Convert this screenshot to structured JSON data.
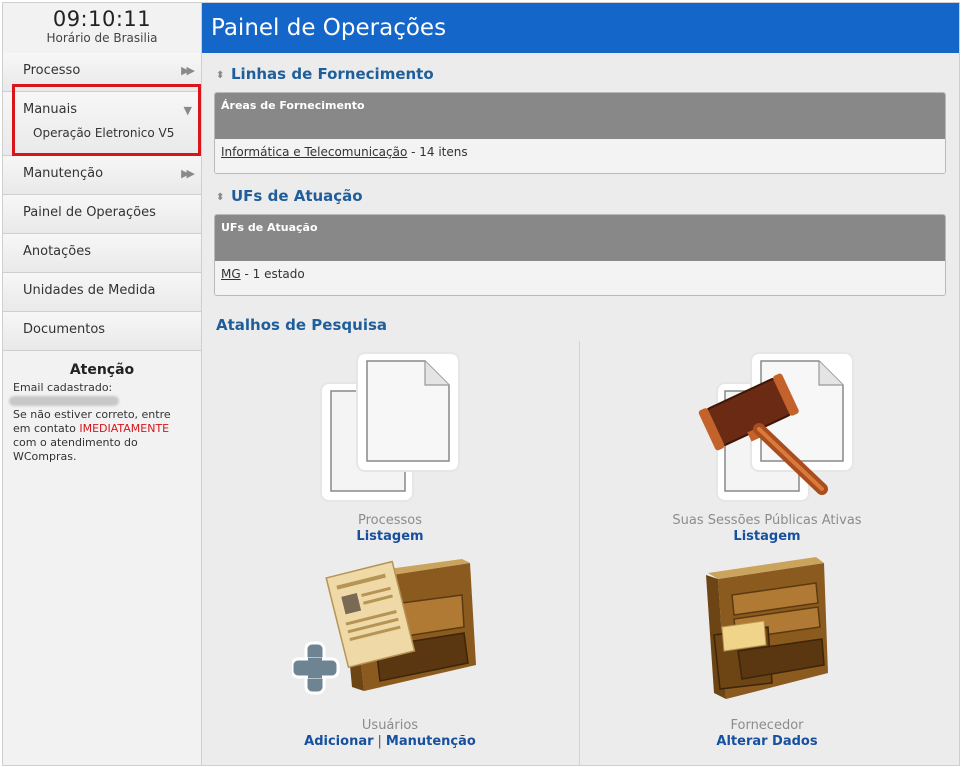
{
  "clock": {
    "time": "09:10:11",
    "timezone": "Horário de Brasilia"
  },
  "sidebar": {
    "items": [
      {
        "label": "Processo"
      },
      {
        "label": "Manuais",
        "sub": "Operação Eletronico V5"
      },
      {
        "label": "Manutenção"
      },
      {
        "label": "Painel de Operações"
      },
      {
        "label": "Anotações"
      },
      {
        "label": "Unidades de Medida"
      },
      {
        "label": "Documentos"
      }
    ],
    "attention": {
      "title": "Atenção",
      "email_label": "Email cadastrado:",
      "msg1": "Se não estiver correto, entre em contato",
      "msg_alert": "IMEDIATAMENTE",
      "msg2": "com o atendimento do WCompras."
    }
  },
  "main": {
    "page_title": "Painel de Operações",
    "supply_lines": {
      "section_title": "Linhas de Fornecimento",
      "table_header": "Áreas de Fornecimento",
      "link": "Informática e Telecomunicação",
      "count": " - 14 itens"
    },
    "ufs": {
      "section_title": "UFs de Atuação",
      "table_header": "UFs de Atuação",
      "link": "MG",
      "count": " - 1 estado"
    },
    "shortcuts": {
      "title": "Atalhos de Pesquisa",
      "processos": {
        "title": "Processos",
        "link": "Listagem"
      },
      "sessoes": {
        "title": "Suas Sessões Públicas Ativas",
        "link": "Listagem"
      },
      "usuarios": {
        "title": "Usuários",
        "link1": "Adicionar",
        "separator": "|",
        "link2": "Manutenção"
      },
      "fornecedor": {
        "title": "Fornecedor",
        "link": "Alterar Dados"
      }
    }
  },
  "colors": {
    "header_blue": "#1466c8",
    "link_blue": "#17509e",
    "alert_red": "#d9141a",
    "table_header_gray": "#888888"
  },
  "icons": [
    "sort-icon",
    "double-chevron-right-icon",
    "double-chevron-down-icon",
    "documents-icon",
    "gavel-icon",
    "file-cabinet-icon",
    "plus-icon"
  ]
}
